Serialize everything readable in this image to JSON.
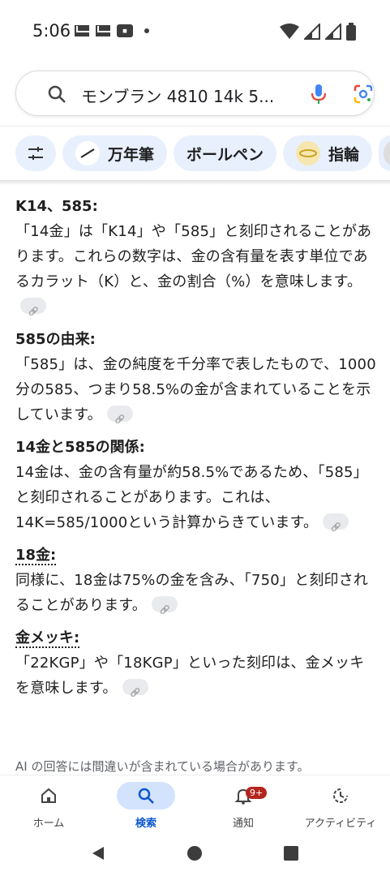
{
  "status_bar": {
    "time": "5:06"
  },
  "search": {
    "query": "モンブラン 4810 14k 5..."
  },
  "chips": [
    {
      "label": "万年筆",
      "icon": "pen-thumbnail"
    },
    {
      "label": "ボールペン",
      "icon": ""
    },
    {
      "label": "指輪",
      "icon": "ring-thumbnail"
    }
  ],
  "sections": [
    {
      "heading": "K14、585:",
      "body": "「14金」は「K14」や「585」と刻印されることがあります。これらの数字は、金の含有量を表す単位であるカラット（K）と、金の割合（%）を意味します。"
    },
    {
      "heading": "585の由来:",
      "body": "「585」は、金の純度を千分率で表したもので、1000分の585、つまり58.5%の金が含まれていることを示しています。"
    },
    {
      "heading": "14金と585の関係:",
      "body": "14金は、金の含有量が約58.5%であるため、「585」と刻印されることがあります。これは、14K=585/1000という計算からきています。"
    },
    {
      "heading": "18金:",
      "body": "同様に、18金は75%の金を含み、「750」と刻印されることがあります。"
    },
    {
      "heading": "金メッキ:",
      "body": "「22KGP」や「18KGP」といった刻印は、金メッキを意味します。"
    }
  ],
  "disclaimer": "AI の回答には間違いが含まれている場合があります。",
  "bottom_nav": {
    "home": "ホーム",
    "search": "検索",
    "notifications": "通知",
    "notification_badge": "9+",
    "activity": "アクティビティ"
  },
  "colors": {
    "accent": "#0b57d0",
    "chip_bg": "#e8f0fe",
    "badge": "#b3261e"
  }
}
